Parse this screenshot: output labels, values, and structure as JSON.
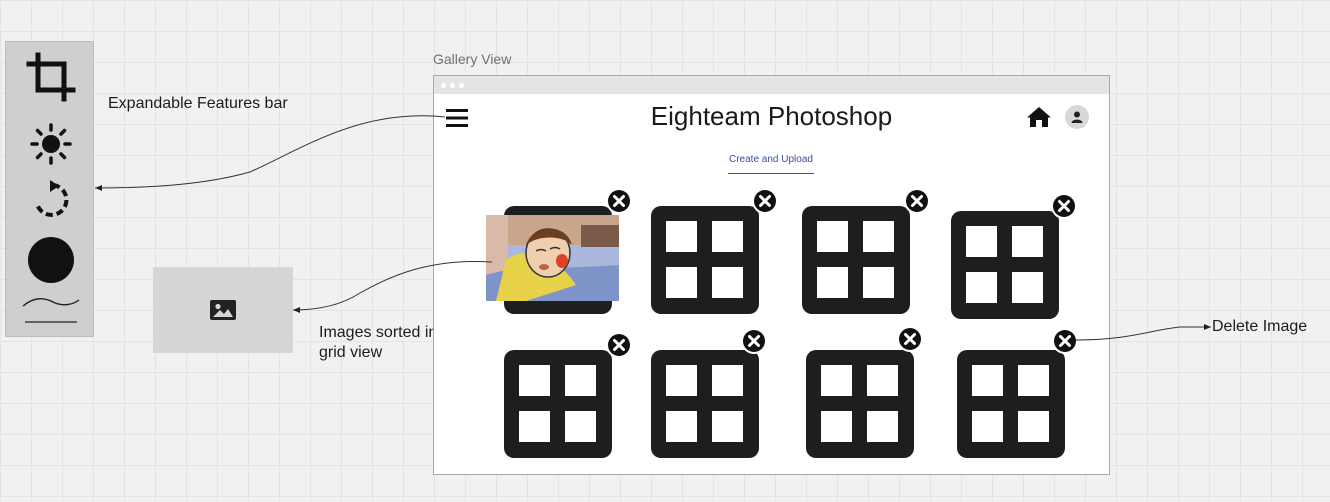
{
  "annotations": {
    "features": "Expandable Features bar",
    "images_grid": "Images sorted in\ngrid view",
    "images_grid_line1": "Images sorted in",
    "images_grid_line2": "grid view",
    "delete": "Delete Image"
  },
  "toolbar": {
    "tools": [
      "crop-icon",
      "brightness-icon",
      "rotate-icon",
      "circle-icon",
      "curve-icon"
    ]
  },
  "placeholder": {
    "icon": "image-icon"
  },
  "gallery": {
    "label": "Gallery View",
    "app_title": "Eighteam Photoshop",
    "tab": "Create and Upload",
    "icons": [
      "hamburger-icon",
      "home-icon",
      "user-icon"
    ],
    "thumbnails": [
      "photo",
      "grid",
      "grid",
      "grid",
      "grid",
      "grid",
      "grid",
      "grid"
    ],
    "delete_icon": "close-icon"
  },
  "colors": {
    "canvas": "#f1f1f1",
    "toolbar": "#cfcfcf",
    "placeholder": "#d6d6d6",
    "thumb": "#1e1e1e",
    "tab_accent": "#3d4ea3"
  }
}
